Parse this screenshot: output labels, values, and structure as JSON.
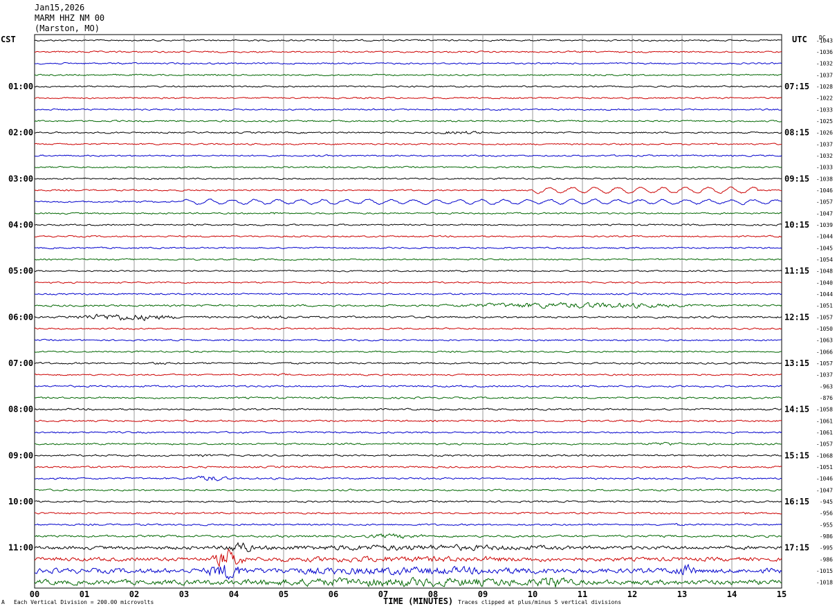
{
  "header": {
    "date": "Jan15,2026",
    "station": "MARM HHZ NM 00",
    "location": "(Marston, MO)"
  },
  "labels": {
    "left_zone": "CST",
    "right_zone": "UTC",
    "dc": "DC",
    "xlabel": "TIME (MINUTES)",
    "scale_note": "Each Vertical Division =  200.00 microvolts",
    "clip_note": "Traces clipped at plus/minus 5 vertical divisions",
    "corner_mark": "A"
  },
  "chart_data": {
    "type": "line",
    "x_ticks": [
      "00",
      "01",
      "02",
      "03",
      "04",
      "05",
      "06",
      "07",
      "08",
      "09",
      "10",
      "11",
      "12",
      "13",
      "14",
      "15"
    ],
    "xlim": [
      0,
      15
    ],
    "grid": true,
    "trace_colors": [
      "#000000",
      "#cc0000",
      "#0000cc",
      "#006600"
    ],
    "left_time_labels": [
      "01:00",
      "02:00",
      "03:00",
      "04:00",
      "05:00",
      "06:00",
      "07:00",
      "08:00",
      "09:00",
      "10:00",
      "11:00"
    ],
    "right_time_labels": [
      "07:15",
      "08:15",
      "09:15",
      "10:15",
      "11:15",
      "12:15",
      "13:15",
      "14:15",
      "15:15",
      "16:15",
      "17:15"
    ],
    "dc_offsets": [
      "-1043",
      "-1036",
      "-1032",
      "-1037",
      "-1028",
      "-1022",
      "-1033",
      "-1025",
      "-1026",
      "-1037",
      "-1032",
      "-1033",
      "-1038",
      "-1046",
      "-1057",
      "-1047",
      "-1039",
      "-1044",
      "-1045",
      "-1054",
      "-1048",
      "-1040",
      "-1044",
      "-1051",
      "-1057",
      "-1050",
      "-1063",
      "-1066",
      "-1057",
      "-1037",
      "-963",
      "-876",
      "-1058",
      "-1061",
      "-1061",
      "-1057",
      "-1068",
      "-1051",
      "-1046",
      "-1047",
      "-945",
      "-956",
      "-955",
      "-986",
      "-995",
      "-986",
      "-1015",
      "-1018"
    ],
    "traces": [
      {
        "amp": 1.6,
        "events": []
      },
      {
        "amp": 1.6,
        "events": []
      },
      {
        "amp": 1.6,
        "events": []
      },
      {
        "amp": 1.6,
        "events": []
      },
      {
        "amp": 1.6,
        "events": []
      },
      {
        "amp": 1.6,
        "events": []
      },
      {
        "amp": 1.6,
        "events": []
      },
      {
        "amp": 1.6,
        "events": []
      },
      {
        "amp": 1.6,
        "events": [
          {
            "start": 7.5,
            "end": 9.6,
            "amp": 3.5
          }
        ]
      },
      {
        "amp": 1.6,
        "events": []
      },
      {
        "amp": 1.6,
        "events": []
      },
      {
        "amp": 1.6,
        "events": []
      },
      {
        "amp": 1.6,
        "events": []
      },
      {
        "amp": 1.6,
        "long_period": {
          "start": 10.0,
          "end": 14.5,
          "amp": 4
        },
        "events": []
      },
      {
        "amp": 1.6,
        "long_period": {
          "start": 3.0,
          "end": 15.0,
          "amp": 3
        },
        "events": []
      },
      {
        "amp": 1.6,
        "events": [
          {
            "start": 4.6,
            "end": 5.0,
            "amp": 3
          }
        ]
      },
      {
        "amp": 1.6,
        "events": []
      },
      {
        "amp": 1.6,
        "events": []
      },
      {
        "amp": 1.6,
        "events": []
      },
      {
        "amp": 1.6,
        "events": []
      },
      {
        "amp": 1.6,
        "events": []
      },
      {
        "amp": 1.6,
        "events": []
      },
      {
        "amp": 1.6,
        "events": []
      },
      {
        "amp": 2.0,
        "events": [
          {
            "start": 6.5,
            "end": 15.0,
            "amp": 6
          }
        ]
      },
      {
        "amp": 2.0,
        "events": [
          {
            "start": 0.0,
            "end": 3.6,
            "amp": 7
          },
          {
            "start": 3.6,
            "end": 6.0,
            "amp": 3
          }
        ]
      },
      {
        "amp": 1.6,
        "events": []
      },
      {
        "amp": 1.6,
        "events": []
      },
      {
        "amp": 1.6,
        "events": []
      },
      {
        "amp": 1.8,
        "events": [
          {
            "start": 2.0,
            "end": 3.0,
            "amp": 3
          }
        ]
      },
      {
        "amp": 1.6,
        "events": [
          {
            "start": 4.8,
            "end": 5.2,
            "amp": 3
          }
        ]
      },
      {
        "amp": 1.8,
        "events": []
      },
      {
        "amp": 1.8,
        "events": []
      },
      {
        "amp": 1.8,
        "events": []
      },
      {
        "amp": 1.8,
        "events": []
      },
      {
        "amp": 1.8,
        "events": []
      },
      {
        "amp": 1.8,
        "events": [
          {
            "start": 12.0,
            "end": 13.3,
            "amp": 4
          }
        ]
      },
      {
        "amp": 1.8,
        "events": [
          {
            "start": 3.0,
            "end": 3.8,
            "amp": 3
          }
        ]
      },
      {
        "amp": 1.8,
        "events": []
      },
      {
        "amp": 1.8,
        "events": [
          {
            "start": 2.8,
            "end": 4.2,
            "amp": 6
          }
        ]
      },
      {
        "amp": 1.8,
        "events": []
      },
      {
        "amp": 1.8,
        "events": []
      },
      {
        "amp": 1.8,
        "events": [
          {
            "start": 14.0,
            "end": 14.5,
            "amp": 3
          }
        ]
      },
      {
        "amp": 1.8,
        "events": [
          {
            "start": 12.6,
            "end": 13.2,
            "amp": 3
          }
        ]
      },
      {
        "amp": 2.2,
        "events": [
          {
            "start": 6.0,
            "end": 8.5,
            "amp": 5
          }
        ]
      },
      {
        "amp": 3.5,
        "events": [
          {
            "start": 0.0,
            "end": 15.0,
            "amp": 6
          },
          {
            "start": 3.6,
            "end": 4.6,
            "amp": 12
          }
        ]
      },
      {
        "amp": 4.0,
        "events": [
          {
            "start": 0.0,
            "end": 15.0,
            "amp": 6
          },
          {
            "start": 3.4,
            "end": 4.4,
            "amp": 20
          }
        ]
      },
      {
        "amp": 5.0,
        "events": [
          {
            "start": 0.0,
            "end": 15.0,
            "amp": 8
          },
          {
            "start": 3.2,
            "end": 4.5,
            "amp": 18
          },
          {
            "start": 12.5,
            "end": 13.6,
            "amp": 12
          }
        ]
      },
      {
        "amp": 5.0,
        "events": [
          {
            "start": 0.0,
            "end": 15.0,
            "amp": 9
          },
          {
            "start": 9.8,
            "end": 11.0,
            "amp": 14
          }
        ]
      }
    ]
  }
}
